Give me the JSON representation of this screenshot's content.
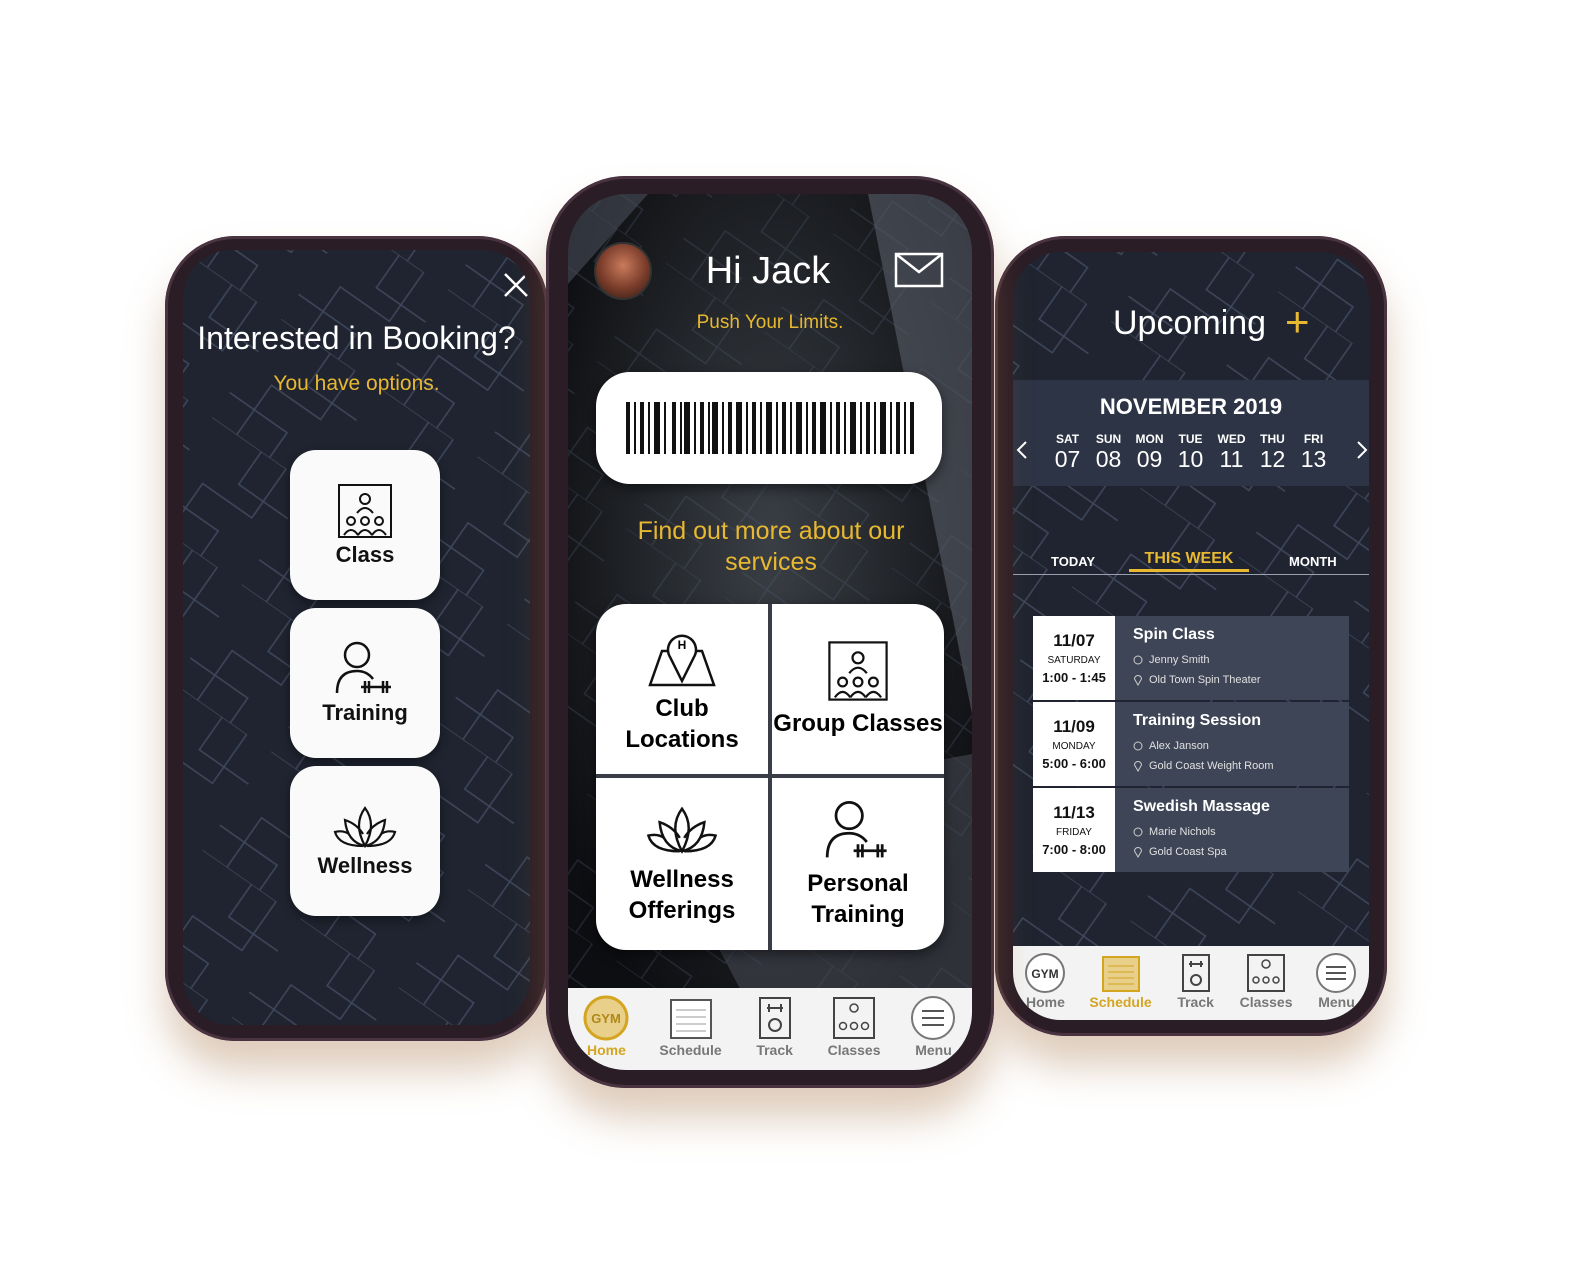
{
  "booking": {
    "title": "Interested in Booking?",
    "subtitle": "You have options.",
    "options": [
      {
        "label": "Class",
        "icon": "class-icon"
      },
      {
        "label": "Training",
        "icon": "trainer-icon"
      },
      {
        "label": "Wellness",
        "icon": "lotus-icon"
      }
    ]
  },
  "home": {
    "greeting": "Hi Jack",
    "tagline": "Push Your Limits.",
    "services_heading": "Find out more about our services",
    "services": [
      {
        "label": "Club Locations",
        "icon": "map-pin-icon"
      },
      {
        "label": "Group Classes",
        "icon": "class-icon"
      },
      {
        "label": "Wellness Offerings",
        "icon": "lotus-icon"
      },
      {
        "label": "Personal Training",
        "icon": "trainer-icon"
      }
    ],
    "nav": [
      {
        "label": "Home",
        "icon_text": "GYM",
        "active": true
      },
      {
        "label": "Schedule",
        "active": false
      },
      {
        "label": "Track",
        "active": false
      },
      {
        "label": "Classes",
        "active": false
      },
      {
        "label": "Menu",
        "active": false
      }
    ]
  },
  "upcoming": {
    "title": "Upcoming",
    "add_symbol": "+",
    "month": "NOVEMBER 2019",
    "days": [
      {
        "name": "SAT",
        "date": "07"
      },
      {
        "name": "SUN",
        "date": "08"
      },
      {
        "name": "MON",
        "date": "09"
      },
      {
        "name": "TUE",
        "date": "10"
      },
      {
        "name": "WED",
        "date": "11"
      },
      {
        "name": "THU",
        "date": "12"
      },
      {
        "name": "FRI",
        "date": "13"
      }
    ],
    "tabs": [
      "TODAY",
      "THIS WEEK",
      "MONTH"
    ],
    "active_tab": "THIS WEEK",
    "events": [
      {
        "date": "11/07",
        "weekday": "SATURDAY",
        "time": "1:00 - 1:45",
        "title": "Spin Class",
        "person": "Jenny Smith",
        "location": "Old Town Spin Theater"
      },
      {
        "date": "11/09",
        "weekday": "MONDAY",
        "time": "5:00 - 6:00",
        "title": "Training Session",
        "person": "Alex Janson",
        "location": "Gold Coast Weight Room"
      },
      {
        "date": "11/13",
        "weekday": "FRIDAY",
        "time": "7:00 - 8:00",
        "title": "Swedish Massage",
        "person": "Marie Nichols",
        "location": "Gold Coast Spa"
      }
    ],
    "nav": [
      {
        "label": "Home",
        "icon_text": "GYM",
        "active": false
      },
      {
        "label": "Schedule",
        "active": true
      },
      {
        "label": "Track",
        "active": false
      },
      {
        "label": "Classes",
        "active": false
      },
      {
        "label": "Menu",
        "active": false
      }
    ]
  },
  "colors": {
    "accent": "#e8b830",
    "screen_bg": "#1f2430",
    "card_bg": "#3e4556",
    "calendar_bg": "#2d3445"
  }
}
